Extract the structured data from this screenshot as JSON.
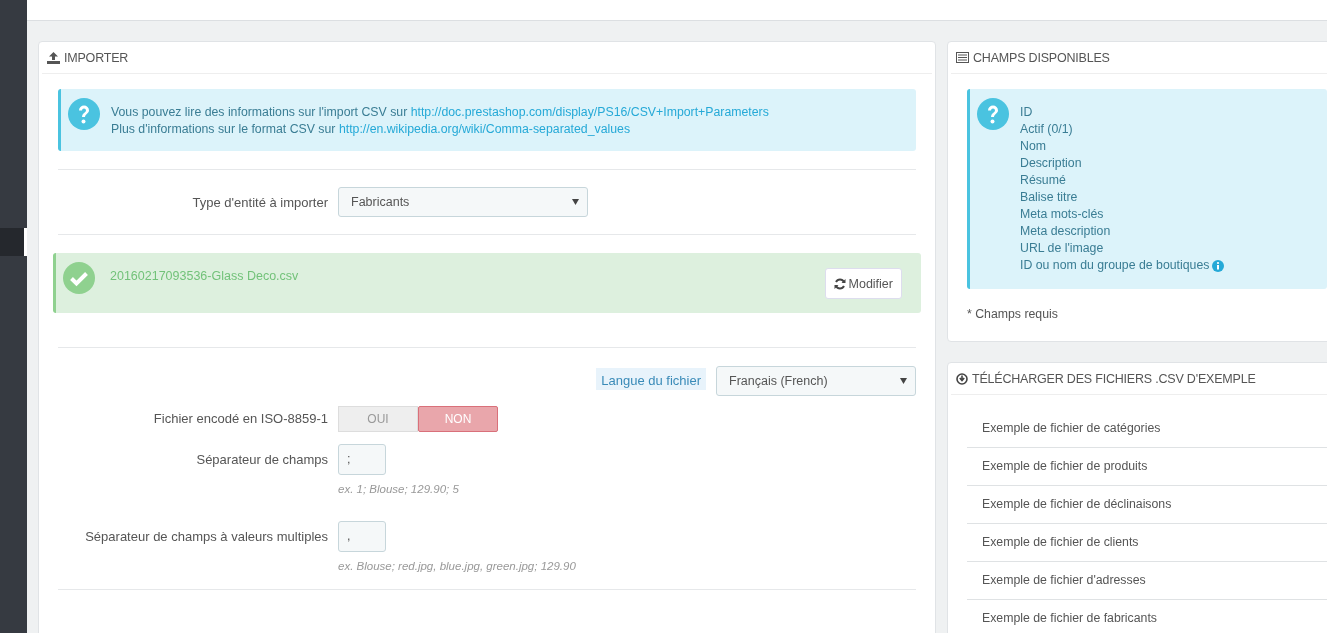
{
  "sidebar": {
    "active_marker": true
  },
  "importer": {
    "title": "IMPORTER",
    "info": [
      {
        "text": "Vous pouvez lire des informations sur l'import CSV sur ",
        "link": "http://doc.prestashop.com/display/PS16/CSV+Import+Parameters"
      },
      {
        "text": "Plus d'informations sur le format CSV sur ",
        "link": "http://en.wikipedia.org/wiki/Comma-separated_values"
      }
    ],
    "entity": {
      "label": "Type d'entité à importer",
      "value": "Fabricants"
    },
    "file": {
      "name": "20160217093536-Glass Deco.csv",
      "button": "Modifier"
    },
    "fields": [
      {
        "kind": "select",
        "label": "Langue du fichier",
        "highlighted": true,
        "value": "Français (French)"
      },
      {
        "kind": "toggle",
        "label": "Fichier encodé en ISO-8859-1",
        "highlighted": false,
        "options": [
          {
            "label": "OUI",
            "selected": false
          },
          {
            "label": "NON",
            "selected": true
          }
        ]
      },
      {
        "kind": "text",
        "label": "Séparateur de champs",
        "highlighted": false,
        "value": ";",
        "help": "ex. 1; Blouse; 129.90; 5"
      },
      {
        "kind": "text",
        "label": "Séparateur de champs à valeurs multiples",
        "highlighted": false,
        "value": ",",
        "help": "ex. Blouse; red.jpg, blue.jpg, green.jpg; 129.90"
      }
    ]
  },
  "available_fields": {
    "title": "CHAMPS DISPONIBLES",
    "items": [
      {
        "text": "ID",
        "info": false
      },
      {
        "text": "Actif (0/1)",
        "info": false
      },
      {
        "text": "Nom",
        "info": false
      },
      {
        "text": "Description",
        "info": false
      },
      {
        "text": "Résumé",
        "info": false
      },
      {
        "text": "Balise titre",
        "info": false
      },
      {
        "text": "Meta mots-clés",
        "info": false
      },
      {
        "text": "Meta description",
        "info": false
      },
      {
        "text": "URL de l'image",
        "info": false
      },
      {
        "text": "ID ou nom du groupe de boutiques",
        "info": true
      }
    ],
    "note": "* Champs requis"
  },
  "samples": {
    "title": "TÉLÉCHARGER DES FICHIERS .CSV D'EXEMPLE",
    "links": [
      "Exemple de fichier de catégories",
      "Exemple de fichier de produits",
      "Exemple de fichier de déclinaisons",
      "Exemple de fichier de clients",
      "Exemple de fichier d'adresses",
      "Exemple de fichier de fabricants"
    ]
  }
}
